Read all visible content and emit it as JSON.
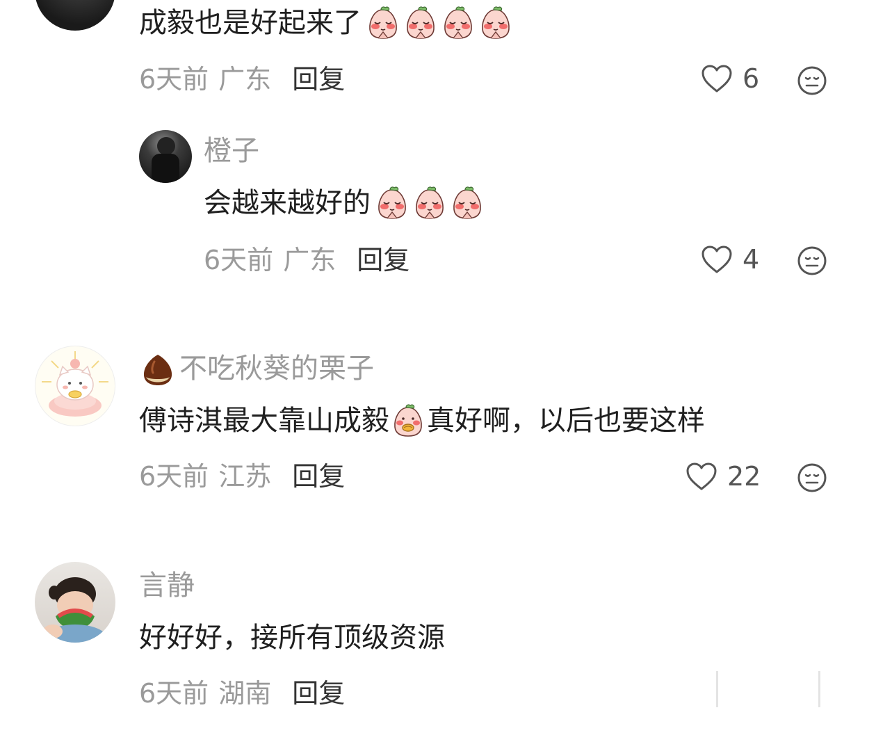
{
  "comments": [
    {
      "text": "成毅也是好起来了",
      "meta": {
        "time": "6天前",
        "location": "广东",
        "reply": "回复"
      },
      "likes": "6"
    },
    {
      "name": "橙子",
      "text": "会越来越好的",
      "meta": {
        "time": "6天前",
        "location": "广东",
        "reply": "回复"
      },
      "likes": "4"
    },
    {
      "name": "不吃秋葵的栗子",
      "text_before": "傅诗淇最大靠山成毅",
      "text_after": "真好啊，以后也要这样",
      "meta": {
        "time": "6天前",
        "location": "江苏",
        "reply": "回复"
      },
      "likes": "22"
    },
    {
      "name": "言静",
      "text": "好好好，接所有顶级资源",
      "meta": {
        "time": "6天前",
        "location": "湖南",
        "reply": "回复"
      }
    }
  ],
  "icons": {
    "like": "heart-outline-icon",
    "face": "neutral-face-icon",
    "emoji_pray": "peach-pray-emoji",
    "emoji_gold": "peach-gold-emoji",
    "name_badge": "chestnut-emoji"
  },
  "colors": {
    "name": "#9a9a9a",
    "text": "#1f1f1f",
    "reply": "#333333",
    "icon": "#555555"
  }
}
